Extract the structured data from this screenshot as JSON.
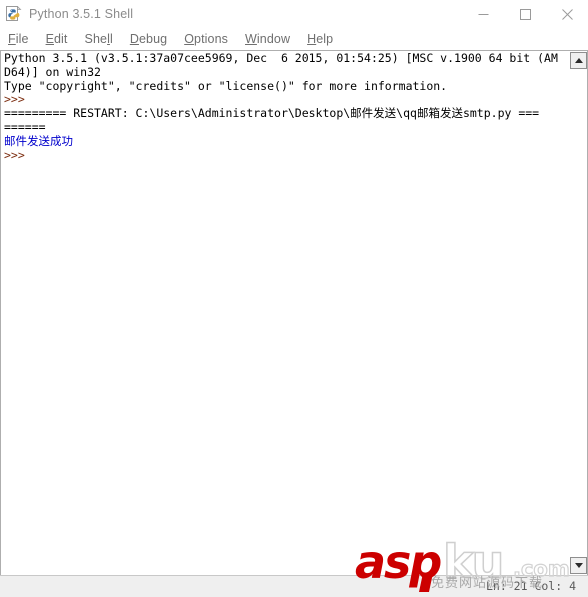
{
  "window": {
    "title": "Python 3.5.1 Shell",
    "icon": "python-idle-icon",
    "controls": {
      "minimize": "minimize-icon",
      "maximize": "maximize-icon",
      "close": "close-icon"
    }
  },
  "menubar": {
    "items": [
      {
        "label": "File",
        "pre": "",
        "acc": "F",
        "post": "ile"
      },
      {
        "label": "Edit",
        "pre": "",
        "acc": "E",
        "post": "dit"
      },
      {
        "label": "Shell",
        "pre": "She",
        "acc": "l",
        "post": "l"
      },
      {
        "label": "Debug",
        "pre": "",
        "acc": "D",
        "post": "ebug"
      },
      {
        "label": "Options",
        "pre": "",
        "acc": "O",
        "post": "ptions"
      },
      {
        "label": "Window",
        "pre": "",
        "acc": "W",
        "post": "indow"
      },
      {
        "label": "Help",
        "pre": "",
        "acc": "H",
        "post": "elp"
      }
    ]
  },
  "shell": {
    "lines": [
      {
        "text": "Python 3.5.1 (v3.5.1:37a07cee5969, Dec  6 2015, 01:54:25) [MSC v.1900 64 bit (AM",
        "kind": "normal"
      },
      {
        "text": "D64)] on win32",
        "kind": "normal"
      },
      {
        "text": "Type \"copyright\", \"credits\" or \"license()\" for more information.",
        "kind": "normal"
      },
      {
        "text": ">>>",
        "kind": "prompt"
      },
      {
        "text": "========= RESTART: C:\\Users\\Administrator\\Desktop\\邮件发送\\qq邮箱发送smtp.py ===",
        "kind": "normal"
      },
      {
        "text": "======",
        "kind": "normal"
      },
      {
        "text": "邮件发送成功",
        "kind": "stdout"
      },
      {
        "text": ">>>",
        "kind": "prompt"
      }
    ]
  },
  "scrollbar": {
    "up_arrow": "scroll-up-arrow-icon",
    "down_arrow": "scroll-down-arrow-icon"
  },
  "statusbar": {
    "position": "Ln: 21  Col: 4"
  },
  "watermark": {
    "brand_red": "asp",
    "brand_gray": "ku",
    "tld": ".com",
    "tagline": "免费网站源码下载",
    "accent_color": "#cc0000"
  }
}
